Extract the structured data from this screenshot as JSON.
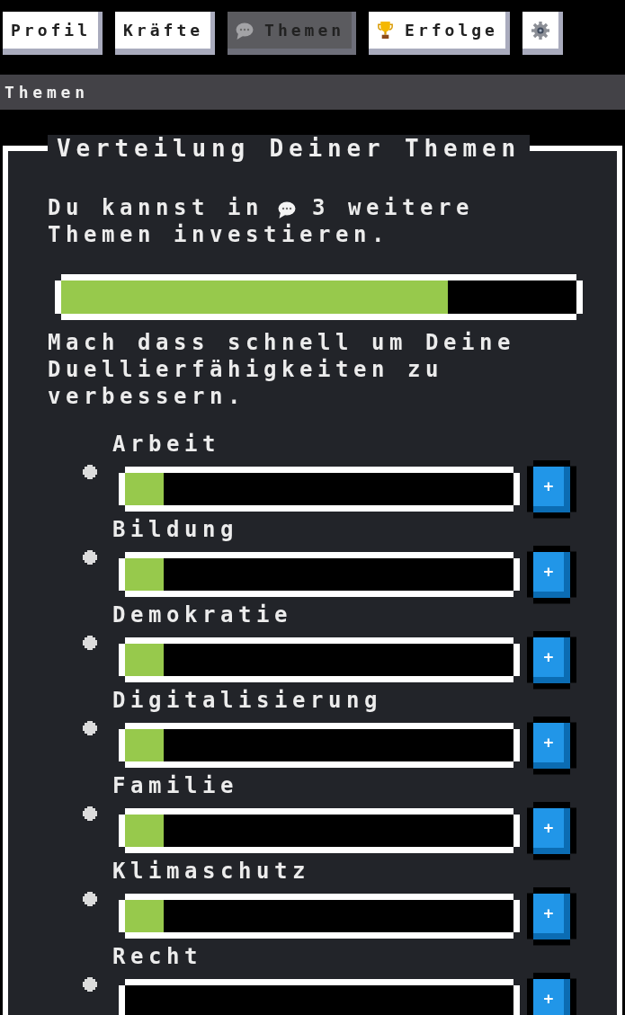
{
  "tabs": [
    {
      "kind": "text",
      "label": "Profil",
      "selected": false
    },
    {
      "kind": "text",
      "label": "Kräfte",
      "selected": false
    },
    {
      "kind": "topics",
      "label": "Themen",
      "selected": true
    },
    {
      "kind": "achievements",
      "label": "Erfolge",
      "selected": false
    },
    {
      "kind": "settings",
      "selected": false
    }
  ],
  "section_header": {
    "title": "Themen"
  },
  "panel": {
    "title": "Verteilung Deiner Themen",
    "points_text": {
      "before_icon": "Du kannst in",
      "after_icon": "3 weitere",
      "second_line": "Themen investieren."
    },
    "progress": {
      "level": 0.75
    },
    "hint": "Mach dass schnell um Deine Duellierfähigkeiten zu verbessern.",
    "topics": [
      {
        "name": "Arbeit",
        "level": 0.1,
        "add_label": "+"
      },
      {
        "name": "Bildung",
        "level": 0.1,
        "add_label": "+"
      },
      {
        "name": "Demokratie",
        "level": 0.1,
        "add_label": "+"
      },
      {
        "name": "Digitalisierung",
        "level": 0.1,
        "add_label": "+"
      },
      {
        "name": "Familie",
        "level": 0.1,
        "add_label": "+"
      },
      {
        "name": "Klimaschutz",
        "level": 0.1,
        "add_label": "+"
      },
      {
        "name": "Recht",
        "add_label": "+"
      }
    ]
  }
}
